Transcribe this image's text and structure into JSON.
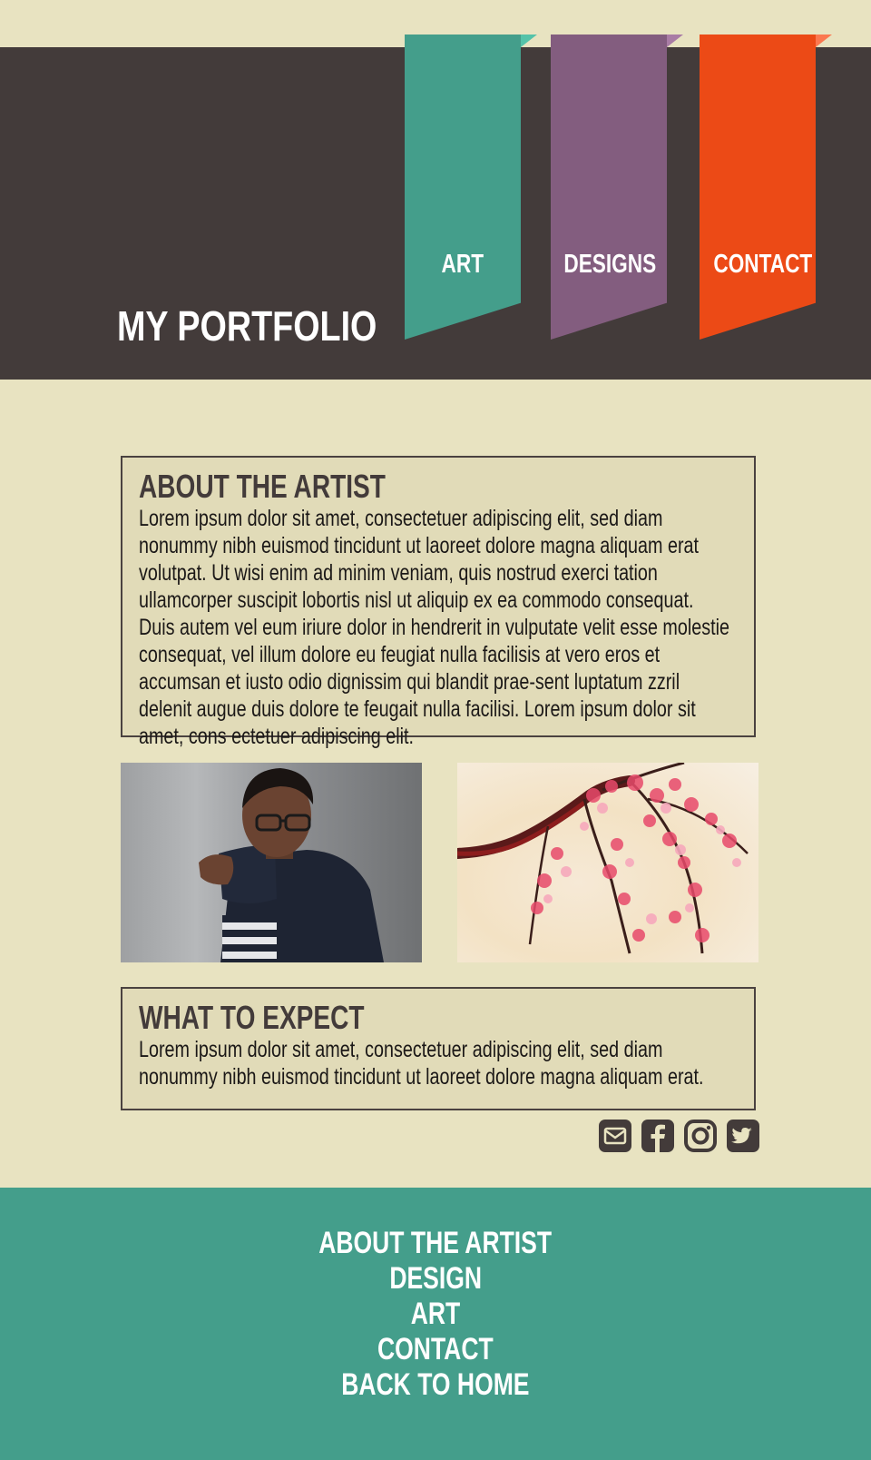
{
  "header": {
    "title": "MY PORTFOLIO",
    "nav": [
      {
        "label": "ART",
        "color": "#449e8b"
      },
      {
        "label": "DESIGNS",
        "color": "#835d7f"
      },
      {
        "label": "CONTACT",
        "color": "#ec4a16"
      }
    ],
    "background": "#433b3a"
  },
  "about": {
    "heading": "ABOUT THE ARTIST",
    "body": "Lorem ipsum dolor sit amet, consectetuer adipiscing elit, sed diam nonummy nibh euismod tincidunt ut laoreet dolore magna aliquam erat volutpat. Ut wisi enim ad minim veniam, quis nostrud exerci tation ullamcorper suscipit lobortis nisl ut aliquip ex ea commodo consequat. Duis autem vel eum iriure dolor in hendrerit in vulputate velit esse molestie consequat, vel illum dolore eu feugiat nulla facilisis at vero eros et accumsan et iusto odio dignissim qui blandit prae-sent luptatum zzril delenit augue duis dolore te feugait nulla facilisi. Lorem ipsum dolor sit amet, cons ectetuer adipiscing elit."
  },
  "images": [
    {
      "name": "portrait-photo"
    },
    {
      "name": "cherry-blossom-painting"
    }
  ],
  "expect": {
    "heading": "WHAT TO EXPECT",
    "body": "Lorem ipsum dolor sit amet, consectetuer adipiscing elit, sed diam nonummy nibh euismod tincidunt ut laoreet dolore magna aliquam erat."
  },
  "social": [
    {
      "icon": "email-icon"
    },
    {
      "icon": "facebook-icon"
    },
    {
      "icon": "instagram-icon"
    },
    {
      "icon": "twitter-icon"
    }
  ],
  "footer": {
    "links": [
      "ABOUT THE ARTIST",
      "DESIGN",
      "ART",
      "CONTACT",
      "BACK TO HOME"
    ],
    "background": "#449e8b"
  },
  "colors": {
    "page_background": "#e8e3c1",
    "box_background": "#e1dbb8",
    "dark": "#433b3a"
  }
}
